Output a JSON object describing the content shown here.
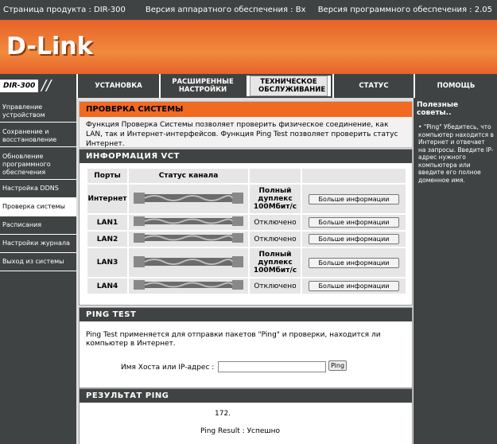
{
  "topbar": {
    "product": "Страница продукта :  DIR-300",
    "hw": "Версия аппаратного обеспечения : Bx",
    "fw": "Версия программного обеспечения : 2.05"
  },
  "brand": {
    "logo": "D-Link",
    "accent": "#f16a21",
    "dark": "#404343"
  },
  "nav": {
    "model": "DIR-300",
    "tabs": [
      {
        "label": "УСТАНОВКА"
      },
      {
        "label": "РАСШИРЕННЫЕ НАСТРОЙКИ"
      },
      {
        "label": "ТЕХНИЧЕСКОЕ ОБСЛУЖИВАНИЕ"
      },
      {
        "label": "СТАТУС"
      },
      {
        "label": "ПОМОЩЬ"
      }
    ]
  },
  "sidebar": {
    "items": [
      {
        "label": "Управление устройством"
      },
      {
        "label": "Сохранение и восстановление"
      },
      {
        "label": "Обновление программного обеспечения"
      },
      {
        "label": "Настройка DDNS"
      },
      {
        "label": "Проверка системы"
      },
      {
        "label": "Расписания"
      },
      {
        "label": "Настройки журнала"
      },
      {
        "label": "Выход из системы"
      }
    ]
  },
  "syscheck": {
    "title": "ПРОВЕРКА СИСТЕМЫ",
    "text": "Функция Проверка Системы позволяет проверить физическое соединение, как LAN, так и Интернет-интерфейсов. Функция Ping Test позволяет проверить статус Интернет."
  },
  "vct": {
    "title": "ИНФОРМАЦИЯ VCT",
    "col_ports": "Порты",
    "col_status": "Статус канала",
    "button": "Больше информации",
    "rows": [
      {
        "port": "Интернет",
        "status": "Полный дуплекс 100Мбит/с"
      },
      {
        "port": "LAN1",
        "status": "Отключено"
      },
      {
        "port": "LAN2",
        "status": "Отключено"
      },
      {
        "port": "LAN3",
        "status": "Полный дуплекс 100Мбит/с"
      },
      {
        "port": "LAN4",
        "status": "Отключено"
      }
    ]
  },
  "ping": {
    "title": "PING TEST",
    "text": "Ping Test применяется для отправки пакетов \"Ping\" и проверки, находится ли компьютер в Интернет.",
    "host_label": "Имя Хоста или IP-адрес :",
    "host_value": "",
    "button": "Ping"
  },
  "result": {
    "title": "РЕЗУЛЬТАТ PING",
    "ip": "172.",
    "status": "Ping Result : Успешно"
  },
  "hints": {
    "title": "Полезные советы..",
    "text": "\"Ping\" Убедитесь, что компьютер находится в Интернет и отвечает на запросы. Введите IP-адрес нужного компьютера или введите его полное доменное имя."
  }
}
